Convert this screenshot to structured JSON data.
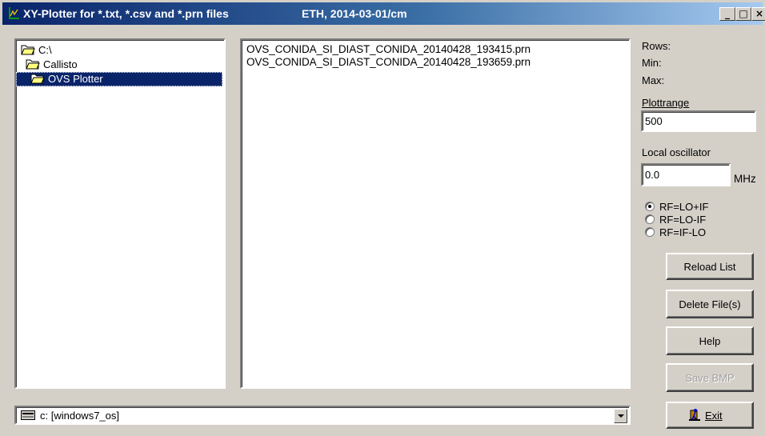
{
  "window": {
    "title": "XY-Plotter for *.txt, *.csv and *.prn files",
    "subtitle": "ETH, 2014-03-01/cm",
    "minimize_glyph": "_",
    "maximize_glyph": "□",
    "close_glyph": "×"
  },
  "directory_tree": [
    {
      "label": "C:\\",
      "selected": false
    },
    {
      "label": "Callisto",
      "selected": false
    },
    {
      "label": "OVS Plotter",
      "selected": true
    }
  ],
  "files": [
    "OVS_CONIDA_SI_DIAST_CONIDA_20140428_193415.prn",
    "OVS_CONIDA_SI_DIAST_CONIDA_20140428_193659.prn"
  ],
  "stats": {
    "rows_label": "Rows:",
    "min_label": "Min:",
    "max_label": "Max:"
  },
  "plotrange": {
    "label": "Plottrange",
    "value": "500"
  },
  "local_oscillator": {
    "label": "Local oscillator",
    "value": "0.0",
    "unit": "MHz"
  },
  "rf_modes": [
    {
      "label": "RF=LO+IF",
      "checked": true
    },
    {
      "label": "RF=LO-IF",
      "checked": false
    },
    {
      "label": "RF=IF-LO",
      "checked": false
    }
  ],
  "buttons": {
    "reload": "Reload List",
    "delete": "Delete File(s)",
    "help": "Help",
    "save_bmp": "Save BMP",
    "exit": "Exit"
  },
  "drive": {
    "value": "c: [windows7_os]"
  },
  "icons": {
    "app": "xy-plot-icon",
    "folder": "folder-icon",
    "drive": "drive-icon",
    "exit": "exit-door-icon"
  },
  "colors": {
    "selection": "#0a246a",
    "titlebar": "#0a246a",
    "face": "#d4d0c8"
  }
}
